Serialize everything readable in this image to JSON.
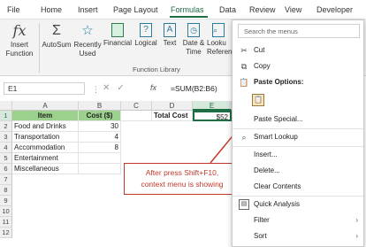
{
  "menubar": {
    "tabs": [
      "File",
      "Home",
      "Insert",
      "Page Layout",
      "Formulas",
      "Data",
      "Review",
      "View",
      "Developer"
    ],
    "active": "Formulas"
  },
  "ribbon": {
    "insert_function": "Insert\nFunction",
    "autosum": "AutoSum",
    "recently_used": "Recently\nUsed",
    "financial": "Financial",
    "logical": "Logical",
    "text": "Text",
    "date_time": "Date &\nTime",
    "lookup": "Looku\nReferen",
    "group_label": "Function Library"
  },
  "formula_bar": {
    "name_box": "E1",
    "fx": "fx",
    "formula": "=SUM(B2:B6)"
  },
  "grid": {
    "columns": [
      "A",
      "B",
      "C",
      "D",
      "E"
    ],
    "rows": [
      "1",
      "2",
      "3",
      "4",
      "5",
      "6",
      "7",
      "8",
      "9",
      "10",
      "11",
      "12"
    ],
    "header_row": {
      "a": "Item",
      "b": "Cost ($)"
    },
    "data": [
      {
        "a": "Food and Drinks",
        "b": "30"
      },
      {
        "a": "Transportation",
        "b": "4"
      },
      {
        "a": "Accommodation",
        "b": "8"
      },
      {
        "a": "Entertainment",
        "b": ""
      },
      {
        "a": "Miscellaneous",
        "b": ""
      }
    ],
    "total_label": "Total Cost",
    "total_value": "$52"
  },
  "callout": {
    "line1": "After press Shift+F10,",
    "line2": "context menu is showing"
  },
  "context_menu": {
    "search_placeholder": "Search the menus",
    "items": {
      "cut": "Cut",
      "copy": "Copy",
      "paste_options": "Paste Options:",
      "paste_special": "Paste Special...",
      "smart_lookup": "Smart Lookup",
      "insert": "Insert...",
      "delete": "Delete...",
      "clear_contents": "Clear Contents",
      "quick_analysis": "Quick Analysis",
      "filter": "Filter",
      "sort": "Sort"
    }
  },
  "colors": {
    "accent": "#1f6e43",
    "header_fill": "#9bd18c",
    "callout": "#c0392b"
  },
  "icons": {
    "insert_function": "fx-icon",
    "autosum": "sigma-icon",
    "recently_used": "star-icon",
    "financial": "book-icon",
    "logical": "question-icon",
    "text": "text-a-icon",
    "date_time": "clock-icon",
    "lookup": "magnifier-icon",
    "cut": "scissors-icon",
    "copy": "copy-icon",
    "paste": "clipboard-icon",
    "smart_lookup": "search-icon",
    "quick_analysis": "chart-icon",
    "submenu": "chevron-right-icon"
  }
}
